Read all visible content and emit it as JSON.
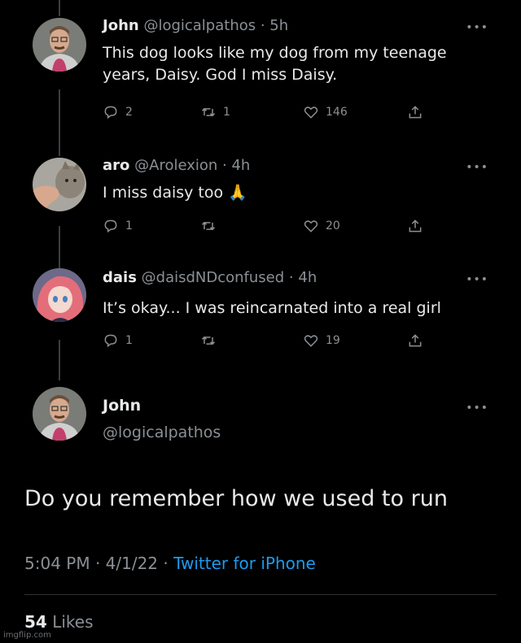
{
  "replies": [
    {
      "name": "John",
      "handle": "@logicalpathos",
      "time": "· 5h",
      "text_line1": "This dog looks like my dog from my teenage",
      "text_line2": "years, Daisy. God I miss Daisy.",
      "counts": {
        "reply": "2",
        "retweet": "1",
        "like": "146"
      }
    },
    {
      "name": "aro",
      "handle": "@Arolexion",
      "time": "· 4h",
      "text_line1": "I miss daisy too",
      "emoji": "🙏",
      "counts": {
        "reply": "1",
        "retweet": "",
        "like": "20"
      }
    },
    {
      "name": "dais",
      "handle": "@daisdNDconfused",
      "time": "· 4h",
      "text_line1": "It’s okay... I was reincarnated into a real girl",
      "counts": {
        "reply": "1",
        "retweet": "",
        "like": "19"
      }
    }
  ],
  "main_tweet": {
    "name": "John",
    "handle": "@logicalpathos",
    "text": "Do you remember how we used to run",
    "time": "5:04 PM · 4/1/22 ·",
    "source": "Twitter for iPhone",
    "likes_count": "54",
    "likes_label": "Likes"
  },
  "more_label": "•••",
  "watermark": "imgflip.com"
}
